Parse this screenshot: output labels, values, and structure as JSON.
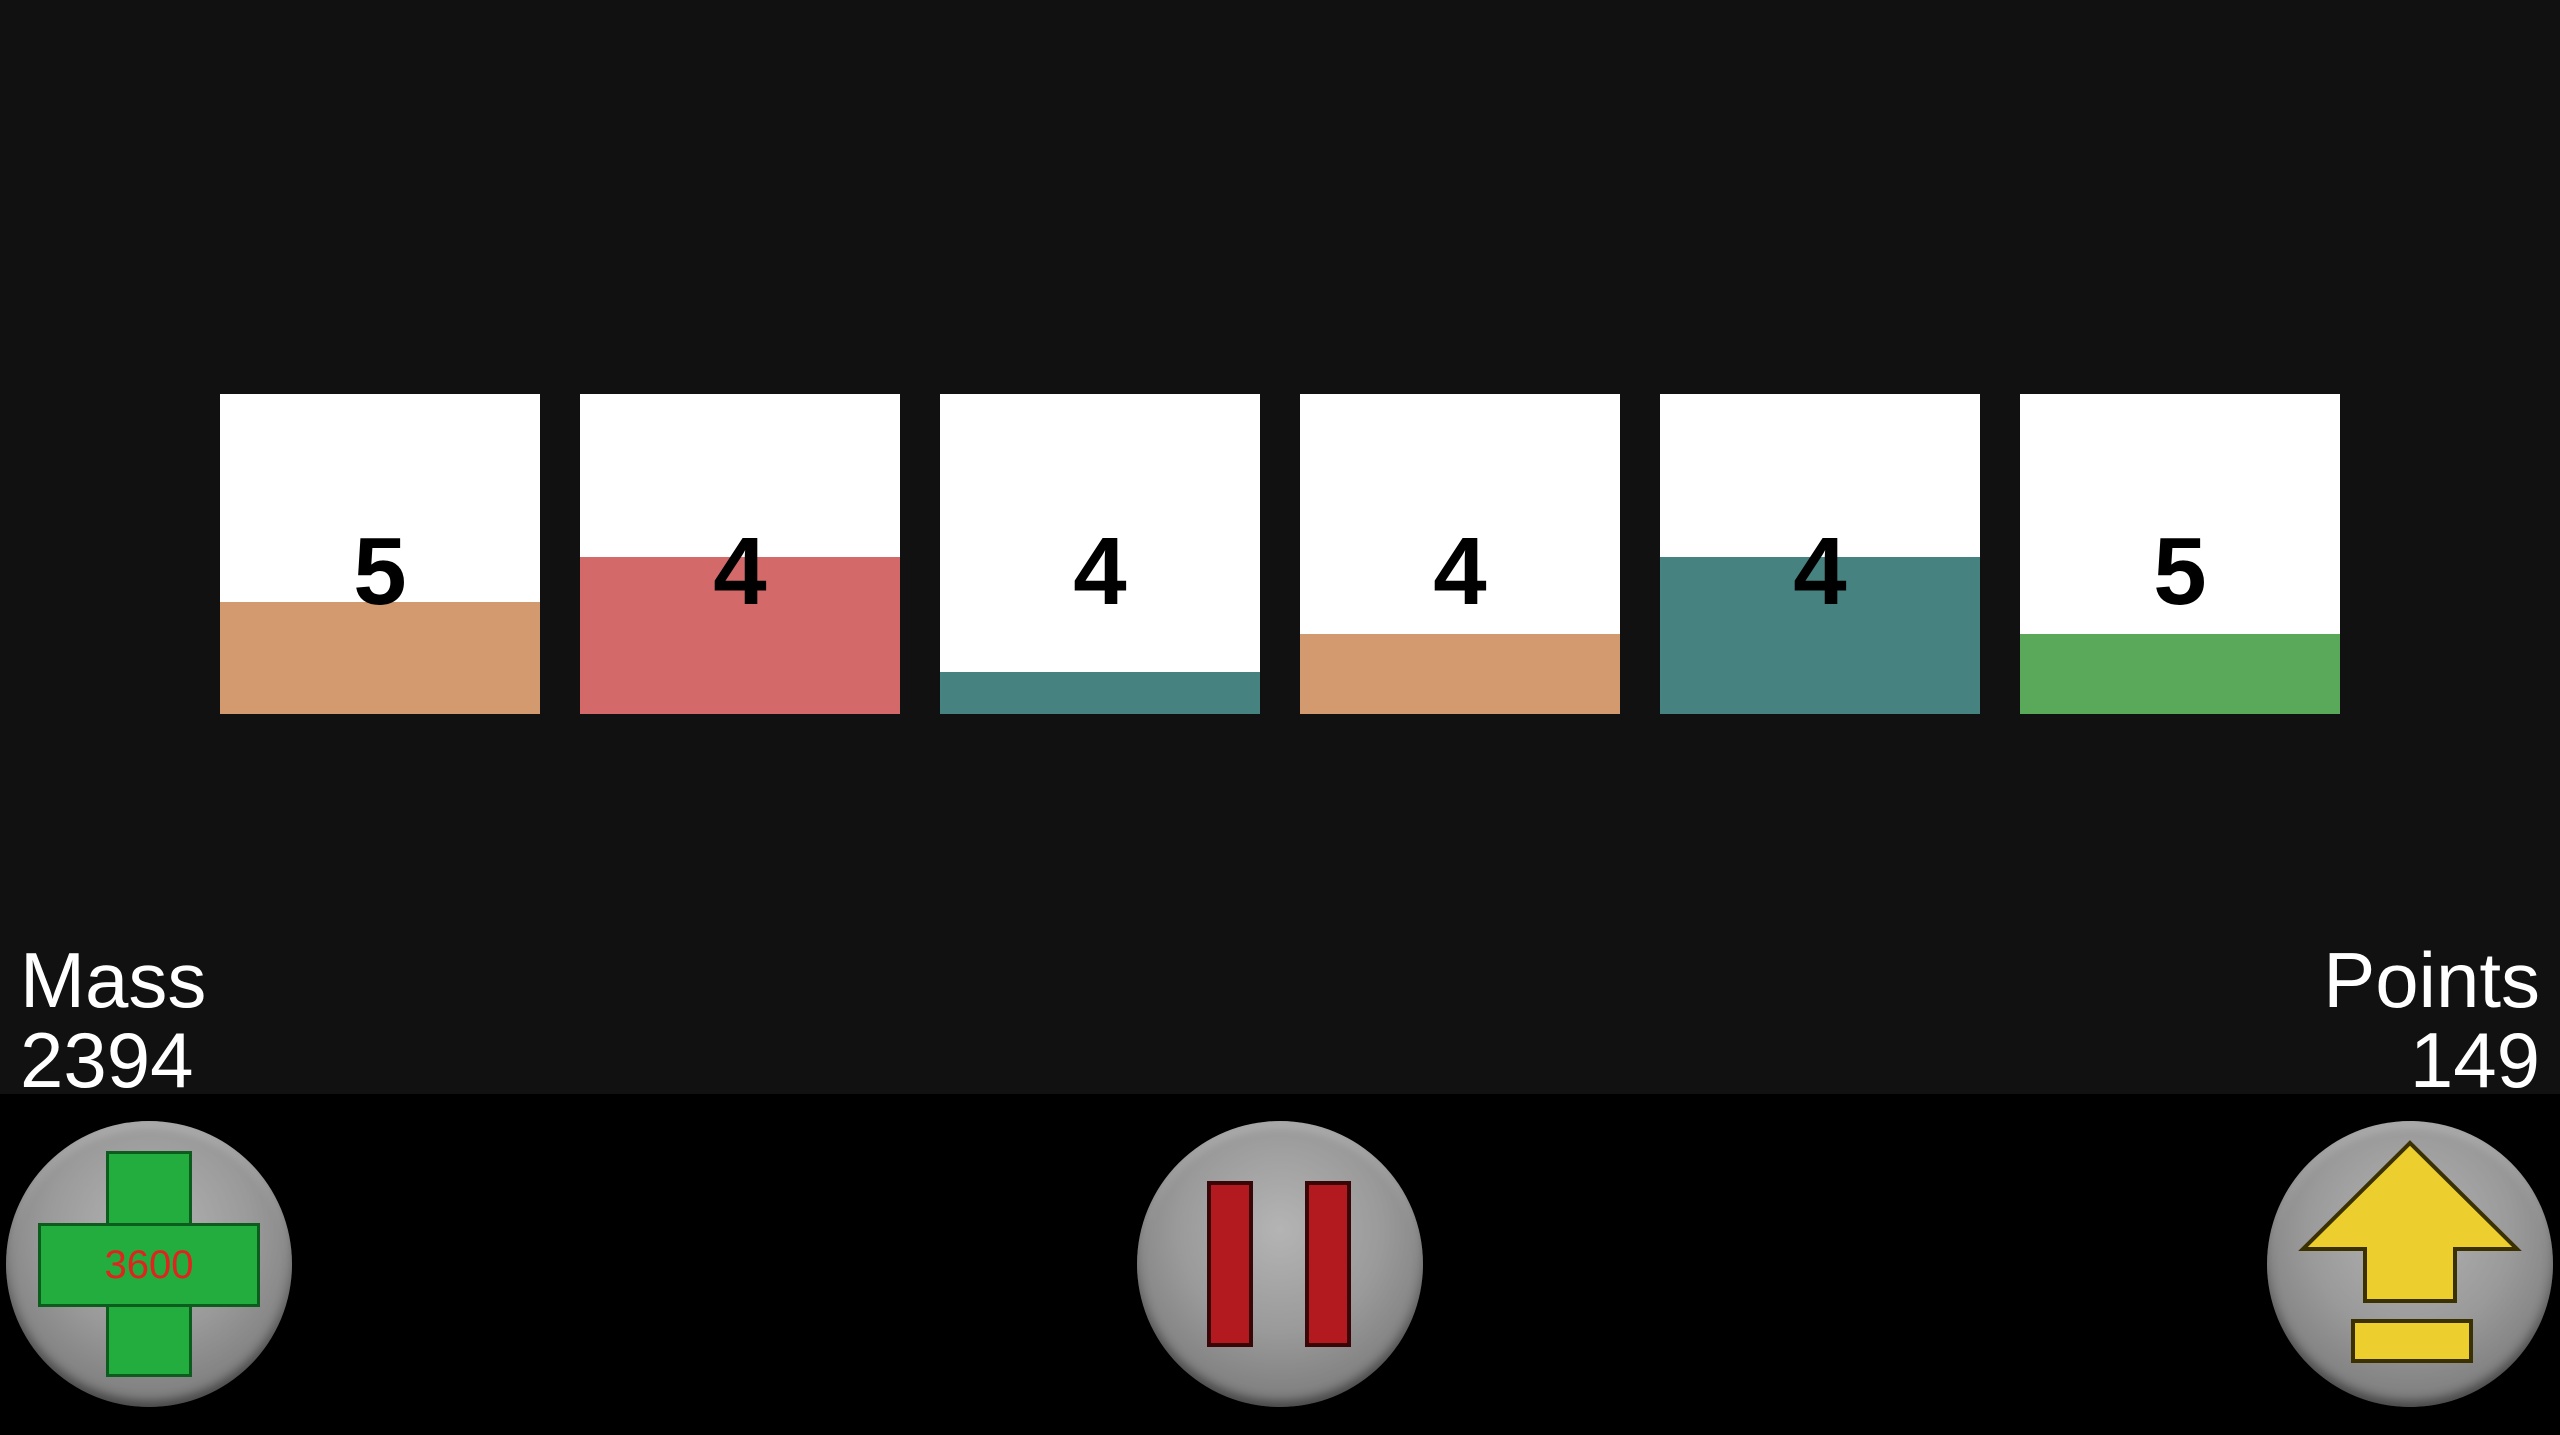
{
  "tiles": [
    {
      "number": "5",
      "fill_level": 0.35,
      "fill_color": "#d29a6e"
    },
    {
      "number": "4",
      "fill_level": 0.49,
      "fill_color": "#d4696a"
    },
    {
      "number": "4",
      "fill_level": 0.13,
      "fill_color": "#458280"
    },
    {
      "number": "4",
      "fill_level": 0.25,
      "fill_color": "#d29a6e"
    },
    {
      "number": "4",
      "fill_level": 0.49,
      "fill_color": "#458280"
    },
    {
      "number": "5",
      "fill_level": 0.25,
      "fill_color": "#5aa95a"
    }
  ],
  "stats": {
    "mass_label": "Mass",
    "mass_value": "2394",
    "points_label": "Points",
    "points_value": "149"
  },
  "controls": {
    "plus_label": "3600",
    "plus_icon": "plus-icon",
    "pause_icon": "pause-icon",
    "up_icon": "arrow-up-icon"
  },
  "colors": {
    "background": "#111111",
    "bar": "#000000",
    "plus_green": "#22ad3e",
    "pause_red": "#b21a1f",
    "arrow_yellow": "#eccf2f"
  }
}
